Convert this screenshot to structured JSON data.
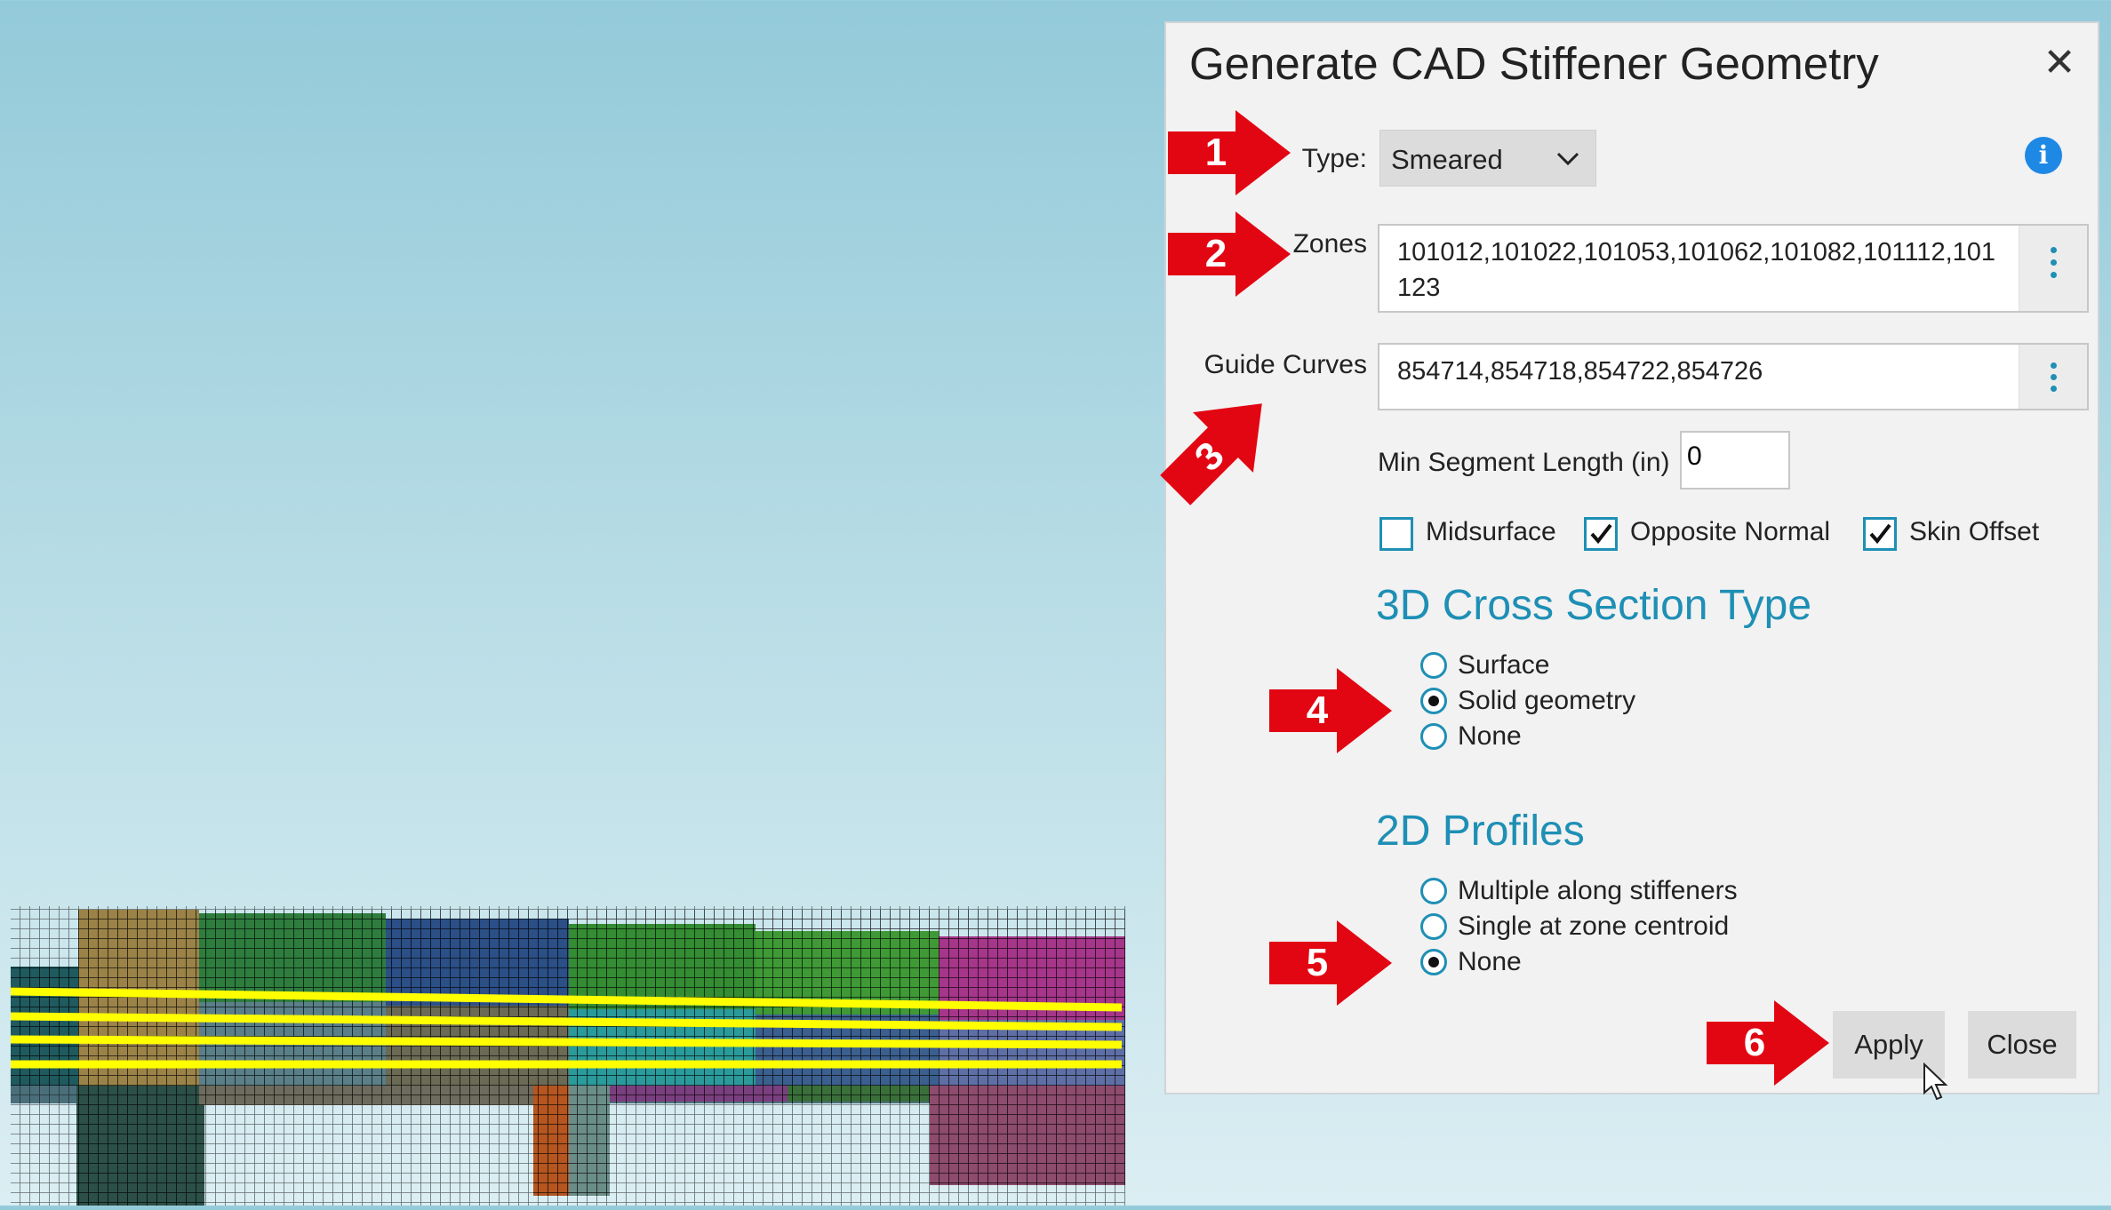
{
  "dialog": {
    "title": "Generate CAD Stiffener Geometry",
    "type_label": "Type:",
    "type_value": "Smeared",
    "zones_label": "Zones",
    "zones_value": "101012,101022,101053,101062,101082,101112,101\n123",
    "guide_label": "Guide Curves",
    "guide_value": "854714,854718,854722,854726",
    "min_seg_label": "Min Segment Length (in)",
    "min_seg_value": "0",
    "checkboxes": [
      {
        "label": "Midsurface",
        "checked": false
      },
      {
        "label": "Opposite Normal",
        "checked": true
      },
      {
        "label": "Skin Offset",
        "checked": true
      }
    ],
    "section_3d": "3D Cross Section Type",
    "radios_3d": [
      {
        "label": "Surface",
        "selected": false
      },
      {
        "label": "Solid geometry",
        "selected": true
      },
      {
        "label": "None",
        "selected": false
      }
    ],
    "section_2d": "2D Profiles",
    "radios_2d": [
      {
        "label": "Multiple along stiffeners",
        "selected": false
      },
      {
        "label": "Single at zone centroid",
        "selected": false
      },
      {
        "label": "None",
        "selected": true
      }
    ],
    "apply_label": "Apply",
    "close_label": "Close"
  },
  "callouts": [
    "1",
    "2",
    "3",
    "4",
    "5",
    "6"
  ],
  "colors": {
    "accent": "#1e8fb5",
    "callout": "#e20613",
    "highlight": "#ffff00",
    "info": "#1e88e5"
  },
  "icons": [
    "close-icon",
    "chevron-down-icon",
    "info-icon",
    "kebab-menu-icon",
    "checkmark-icon",
    "mouse-cursor-icon"
  ]
}
